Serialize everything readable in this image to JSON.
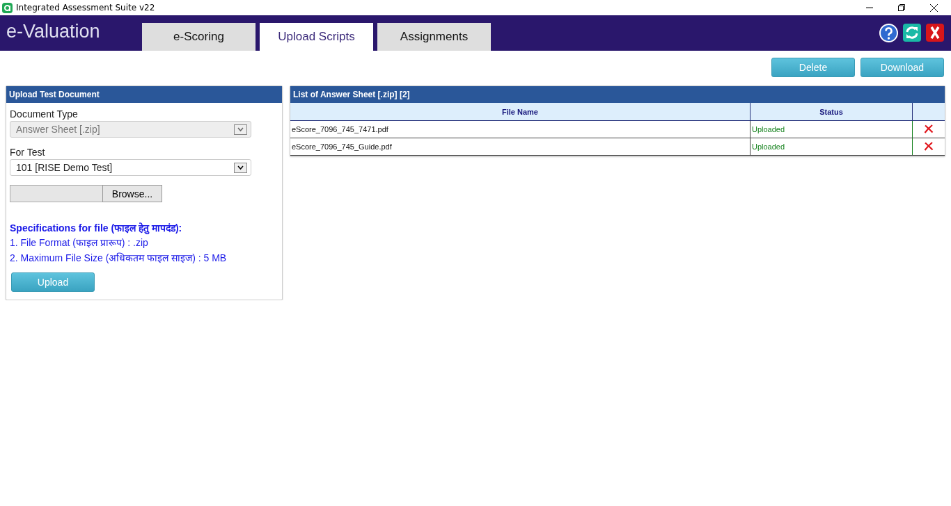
{
  "window": {
    "title": "Integrated Assessment Suite v22"
  },
  "header": {
    "brand": "e-Valuation",
    "tabs": [
      {
        "label": "e-Scoring",
        "selected": false
      },
      {
        "label": "Upload Scripts",
        "selected": true
      },
      {
        "label": "Assignments",
        "selected": false
      }
    ]
  },
  "actions": [
    "Delete",
    "Download"
  ],
  "upload_panel": {
    "title": "Upload Test Document",
    "fields": [
      {
        "label": "Document Type",
        "value": "Answer Sheet [.zip]",
        "disabled": true
      },
      {
        "label": "For Test",
        "value": "101 [RISE Demo Test]",
        "disabled": false
      }
    ],
    "browse_button": "Browse...",
    "spec_title": "Specifications for file (फाइल हेतु मापदंड):",
    "specs": [
      "1. File Format (फाइल प्रारूप) : .zip",
      "2. Maximum File Size (अधिकतम फाइल साइज) : 5 MB"
    ],
    "upload_button": "Upload"
  },
  "file_list": {
    "title": "List of Answer Sheet [.zip] [2]",
    "columns": [
      "File Name",
      "Status"
    ],
    "rows": [
      {
        "file_name": "eScore_7096_745_7471.pdf",
        "status": "Uploaded"
      },
      {
        "file_name": "eScore_7096_745_Guide.pdf",
        "status": "Uploaded"
      }
    ]
  }
}
